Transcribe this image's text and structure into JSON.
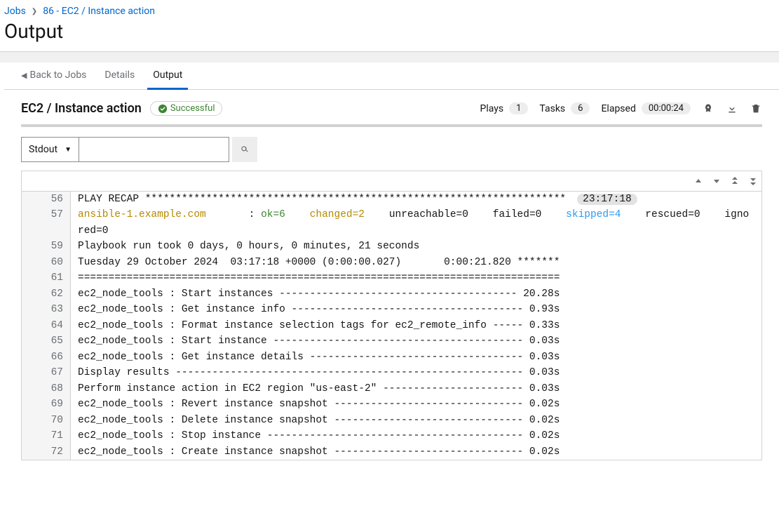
{
  "breadcrumb": {
    "root": "Jobs",
    "current": "86 - EC2 / Instance action"
  },
  "page_title": "Output",
  "tabs": {
    "back": "Back to Jobs",
    "details": "Details",
    "output": "Output"
  },
  "job": {
    "name": "EC2 / Instance action",
    "status_label": "Successful"
  },
  "stats": {
    "plays_label": "Plays",
    "plays_count": "1",
    "tasks_label": "Tasks",
    "tasks_count": "6",
    "elapsed_label": "Elapsed",
    "elapsed_value": "00:00:24"
  },
  "toolbar": {
    "stream_select": "Stdout",
    "search_placeholder": ""
  },
  "recap_time": "23:17:18",
  "recap": {
    "host": "ansible-1.example.com",
    "ok": "ok=6",
    "changed": "changed=2",
    "unreachable": "unreachable=0",
    "failed": "failed=0",
    "skipped": "skipped=4",
    "rescued": "rescued=0",
    "ignored": "ignored=0"
  },
  "lines": [
    {
      "n": "56",
      "raw": "PLAY RECAP *********************************************************************"
    },
    {
      "n": "57",
      "recap": true
    },
    {
      "n": "",
      "raw": "red=0",
      "indent_only": true
    },
    {
      "n": "59",
      "raw": "Playbook run took 0 days, 0 hours, 0 minutes, 21 seconds"
    },
    {
      "n": "60",
      "raw": "Tuesday 29 October 2024  03:17:18 +0000 (0:00:00.027)       0:00:21.820 *******"
    },
    {
      "n": "61",
      "raw": "==============================================================================="
    },
    {
      "n": "62",
      "raw": "ec2_node_tools : Start instances --------------------------------------- 20.28s"
    },
    {
      "n": "63",
      "raw": "ec2_node_tools : Get instance info -------------------------------------- 0.93s"
    },
    {
      "n": "64",
      "raw": "ec2_node_tools : Format instance selection tags for ec2_remote_info ----- 0.33s"
    },
    {
      "n": "65",
      "raw": "ec2_node_tools : Start instance ----------------------------------------- 0.03s"
    },
    {
      "n": "66",
      "raw": "ec2_node_tools : Get instance details ----------------------------------- 0.03s"
    },
    {
      "n": "67",
      "raw": "Display results --------------------------------------------------------- 0.03s"
    },
    {
      "n": "68",
      "raw": "Perform instance action in EC2 region \"us-east-2\" ----------------------- 0.03s"
    },
    {
      "n": "69",
      "raw": "ec2_node_tools : Revert instance snapshot ------------------------------- 0.02s"
    },
    {
      "n": "70",
      "raw": "ec2_node_tools : Delete instance snapshot ------------------------------- 0.02s"
    },
    {
      "n": "71",
      "raw": "ec2_node_tools : Stop instance ------------------------------------------ 0.02s"
    },
    {
      "n": "72",
      "raw": "ec2_node_tools : Create instance snapshot ------------------------------- 0.02s"
    }
  ]
}
